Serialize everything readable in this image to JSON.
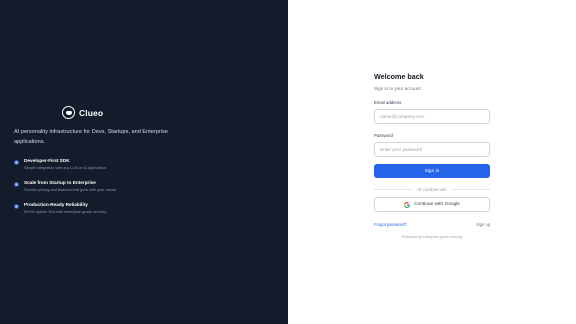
{
  "brand": {
    "name": "Clueo",
    "tagline": "AI personality infrastructure for Devs, Startups, and Enterprise applications."
  },
  "features": [
    {
      "title": "Developer-First SDK",
      "description": "Simple integration with any LLM or AI application."
    },
    {
      "title": "Scale from Startup to Enterprise",
      "description": "Flexible pricing and features that grow with your needs."
    },
    {
      "title": "Production-Ready Reliability",
      "description": "99.9% uptime SLA with enterprise-grade security."
    }
  ],
  "form": {
    "title": "Welcome back",
    "subtitle": "Sign in to your account",
    "email_label": "Email address",
    "email_placeholder": "name@company.com",
    "email_value": "",
    "password_label": "Password",
    "password_placeholder": "Enter your password",
    "password_value": "",
    "signin_label": "Sign in",
    "divider_text": "Or continue with",
    "google_label": "Continue with Google",
    "forgot_label": "Forgot password?",
    "signup_label": "Sign up",
    "secured_text": "Protected by enterprise-grade security"
  },
  "colors": {
    "left_bg": "#141c2c",
    "accent": "#2563eb"
  },
  "icons": {
    "logo": "clueo-logo-icon",
    "feature_bullet": "bullet-dot-icon",
    "google": "google-icon"
  }
}
